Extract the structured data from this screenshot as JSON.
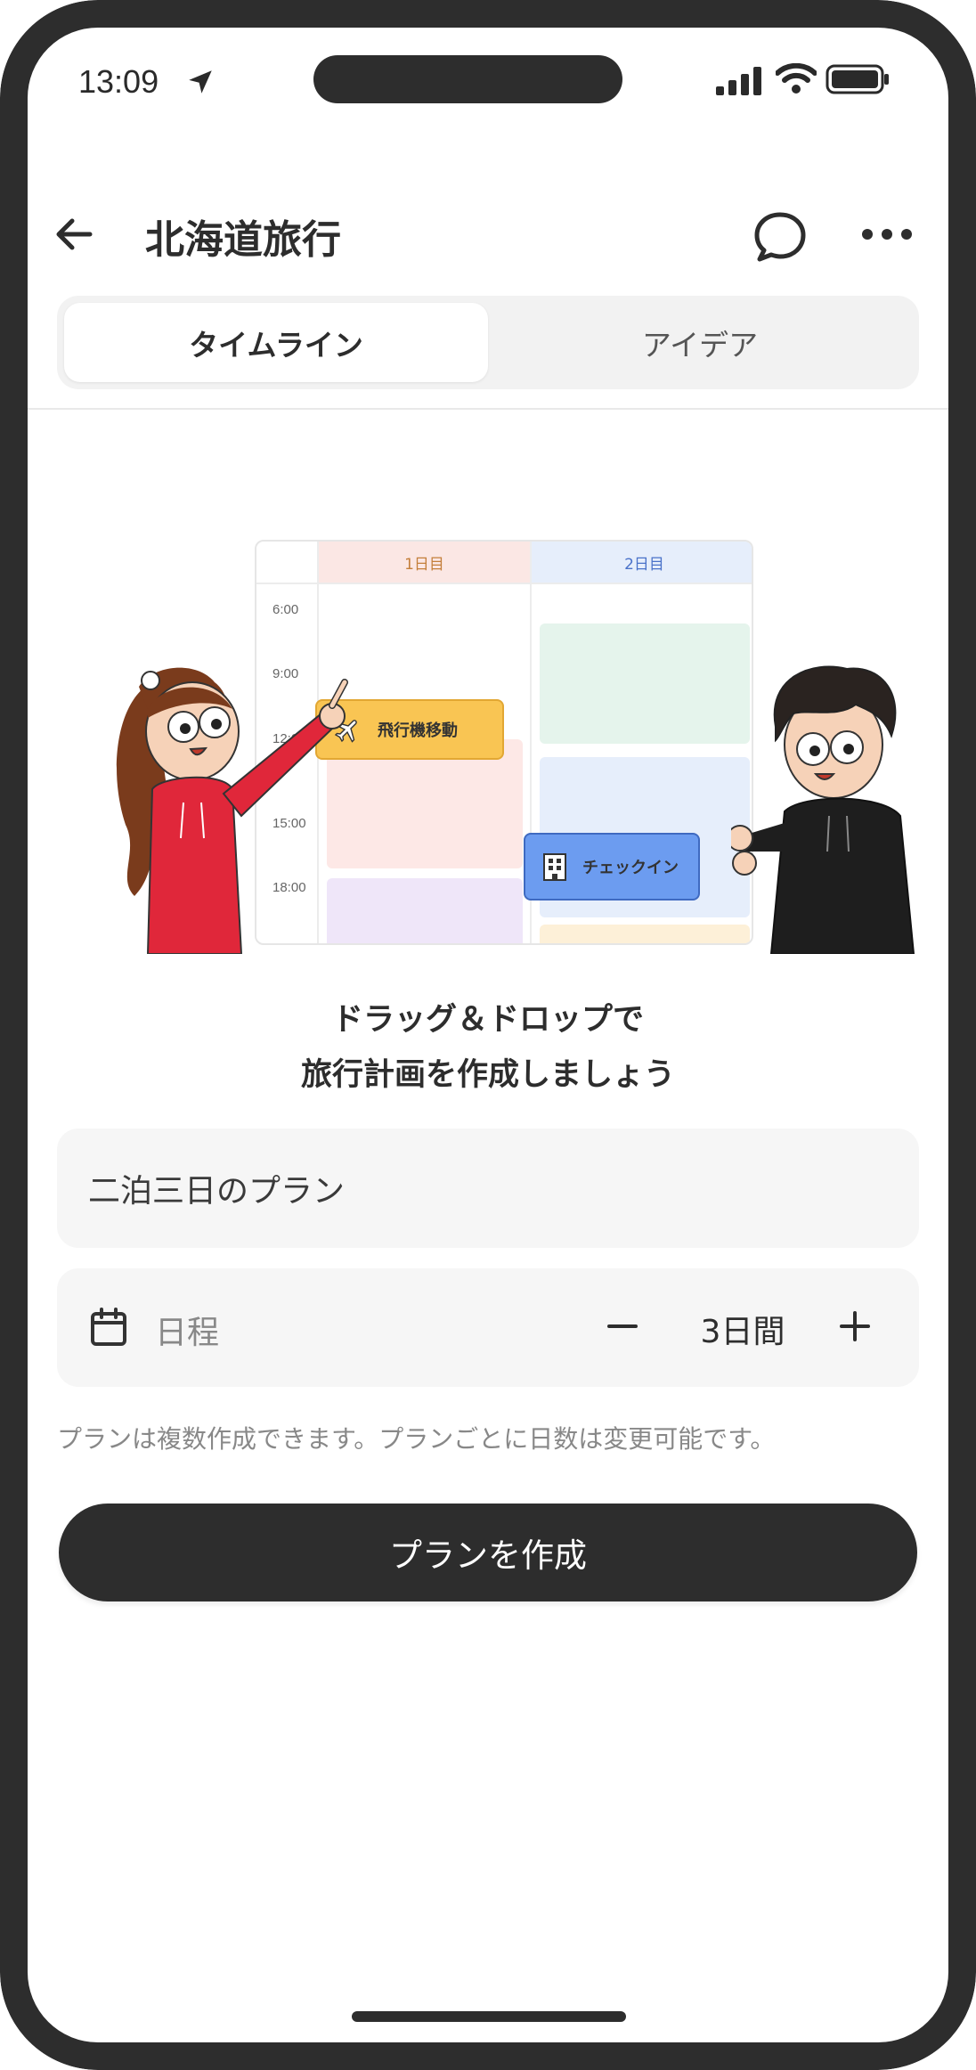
{
  "status_bar": {
    "time": "13:09"
  },
  "header": {
    "title": "北海道旅行"
  },
  "tabs": [
    {
      "label": "タイムライン",
      "active": true
    },
    {
      "label": "アイデア",
      "active": false
    }
  ],
  "illustration": {
    "day_headers": [
      "1日目",
      "2日目"
    ],
    "hours": [
      "6:00",
      "9:00",
      "12:00",
      "15:00",
      "18:00"
    ],
    "chips": [
      "飛行機移動",
      "チェックイン"
    ]
  },
  "headline": {
    "line1": "ドラッグ＆ドロップで",
    "line2": "旅行計画を作成しましょう"
  },
  "plan_name": {
    "value": "二泊三日のプラン"
  },
  "dates": {
    "label": "日程",
    "days": "3日間"
  },
  "hint": "プランは複数作成できます。プランごとに日数は変更可能です。",
  "create_button": "プランを作成",
  "colors": {
    "primary": "#2d2d2d",
    "field_bg": "#f6f6f6",
    "flight_chip": "#f9c553",
    "checkin_chip": "#6c9cf0"
  }
}
